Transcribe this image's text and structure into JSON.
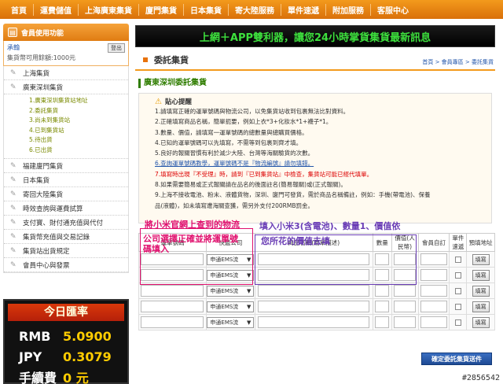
{
  "nav": [
    "首頁",
    "運費儲值",
    "上海廣東集貨",
    "廈門集貨",
    "日本集貨",
    "寄大陸服務",
    "單件速遞",
    "附加服務",
    "客服中心"
  ],
  "member": {
    "title": "會員使用功能",
    "username": "承翰",
    "balance": "集貨幣可用餘額:1000元",
    "logout": "登出"
  },
  "menu": {
    "shanghai": "上海集貨",
    "guangdong": "廣東深圳集貨",
    "sub": [
      "1.廣東深圳集貨站地址",
      "2.委託集貨",
      "3.尚未到集貨站",
      "4.已到集貨站",
      "5.待出貨",
      "6.已出貨"
    ],
    "rest": [
      "福建廈門集貨",
      "日本集貨",
      "寄回大陸集貨",
      "時效查詢與運費試算",
      "支付寶、財付通充值與代付",
      "集貨幣充值與交易記錄",
      "集貨站出貨規定",
      "會員中心與發票"
    ]
  },
  "rates": {
    "title": "今日匯率",
    "rows": [
      {
        "cur": "RMB",
        "val": "5.0900"
      },
      {
        "cur": "JPY",
        "val": "0.3079"
      },
      {
        "cur": "手續費",
        "val": "0 元"
      }
    ]
  },
  "banner": "上網＋APP雙利器，讓您24小時掌貨集貨最新訊息",
  "page": {
    "title": "委託集貨",
    "breadcrumb": "首頁 > 會員專區 > 委託集貨",
    "section": "廣東深圳委託集貨"
  },
  "notice": {
    "head": "貼心提醒",
    "lines": [
      "1.請填寫正確的運單號碼與物流公司，以免集貨站收到包裹無法比對資料。",
      "2.正確填寫商品名稱，簡單扼要，例如上衣*3+化妝水*1+襪子*1。",
      "3.數量、價值，請填寫一運單號碼的總數量與總購買價格。",
      "4.已知的運單號碼可以先填寫，不需等到包裹到齊才填。",
      "5.良好的報關習慣有利於減少大陸、台灣等海關驗貨的次數。",
      "6.查詢運單號碼教學，運單號碼不是『物流編號』請勿填錯。",
      "7.填寫時出現『不受理』時，請到『已到集貨站』中檢查，集貨站可能已經代填單。",
      "8.如果需要簡易或正式報關請在品名的後面註名(簡易報關)或(正式報關)。",
      "9.上海不接收電池、粉末、液體貨物，深圳、廈門可發貨，需於商品名稱備註，例如：手機(帶電池)、保養",
      "品(液體)，如未填寫遭海關查獲，需另外支付200RMB罰金。"
    ]
  },
  "annotations": {
    "red1": "將小米官網上查到的物流",
    "red2": "公司選擇正確並將運單號",
    "red3": "碼填入",
    "purple1": "填入小米3(含電池)、數量1、價值依",
    "purple2": "您所花的價值去填"
  },
  "table": {
    "headers": [
      "運單號碼",
      "快遞公司",
      "商品名稱(簡單描述)",
      "數量",
      "價值(人民幣)",
      "會員自訂",
      "單件速遞",
      "預填地址"
    ],
    "courier_option": "申通EMS流",
    "fill_label": "填寫",
    "rows": 5
  },
  "submit": "確定委託集貨送件",
  "watermark": "#2856542"
}
